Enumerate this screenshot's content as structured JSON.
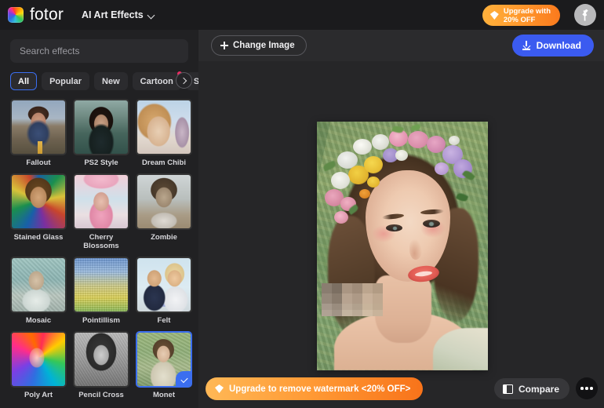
{
  "app": {
    "brand": "fotor",
    "logo_icon": "fotor-color-wheel-icon",
    "module": "AI Art Effects",
    "module_chevron_icon": "chevron-down-icon"
  },
  "header": {
    "upgrade": {
      "label": "Upgrade with\n20% OFF",
      "icon": "diamond-icon",
      "gradient_from": "#ffb13c",
      "gradient_to": "#fb7a1d"
    },
    "avatar": {
      "icon": "bird-avatar-icon",
      "background": "#b9b9bb"
    }
  },
  "sidebar": {
    "search": {
      "placeholder": "Search effects",
      "value": ""
    },
    "tabs": [
      {
        "label": "All",
        "selected": true,
        "badge": false
      },
      {
        "label": "Popular",
        "selected": false,
        "badge": false
      },
      {
        "label": "New",
        "selected": false,
        "badge": false
      },
      {
        "label": "Cartoon",
        "selected": false,
        "badge": true
      },
      {
        "label": "Sketch",
        "selected": false,
        "badge": true
      }
    ],
    "tabs_next_icon": "chevron-right-icon",
    "effects": [
      {
        "label": "Fallout",
        "art": "a-fallout",
        "selected": false
      },
      {
        "label": "PS2 Style",
        "art": "a-ps2",
        "selected": false
      },
      {
        "label": "Dream Chibi",
        "art": "a-chibi",
        "selected": false
      },
      {
        "label": "Stained Glass",
        "art": "a-stained",
        "selected": false
      },
      {
        "label": "Cherry Blossoms",
        "art": "a-cherry",
        "selected": false
      },
      {
        "label": "Zombie",
        "art": "a-zombie",
        "selected": false
      },
      {
        "label": "Mosaic",
        "art": "a-mosaic",
        "selected": false
      },
      {
        "label": "Pointillism",
        "art": "a-point",
        "selected": false
      },
      {
        "label": "Felt",
        "art": "a-felt",
        "selected": false
      },
      {
        "label": "Poly Art",
        "art": "a-poly",
        "selected": false
      },
      {
        "label": "Pencil Cross",
        "art": "a-pencil",
        "selected": false
      },
      {
        "label": "Monet",
        "art": "a-monet",
        "selected": true
      }
    ],
    "selected_effect": "Monet",
    "selected_check_icon": "check-icon"
  },
  "canvas": {
    "toolbar": {
      "change_image_label": "Change Image",
      "change_image_icon": "plus-icon",
      "download_label": "Download",
      "download_icon": "download-arrow-icon",
      "download_color": "#3b5bf0"
    },
    "preview": {
      "description": "Impressionist oil-painting portrait of a woman wearing a floral flower crown",
      "watermark_overlay": "pixelated-mosaic-block"
    }
  },
  "bottom": {
    "upgrade_watermark_label": "Upgrade to remove watermark <20% OFF>",
    "upgrade_watermark_icon": "diamond-icon",
    "compare_label": "Compare",
    "compare_icon": "compare-split-icon",
    "more_icon": "more-dots-icon"
  }
}
